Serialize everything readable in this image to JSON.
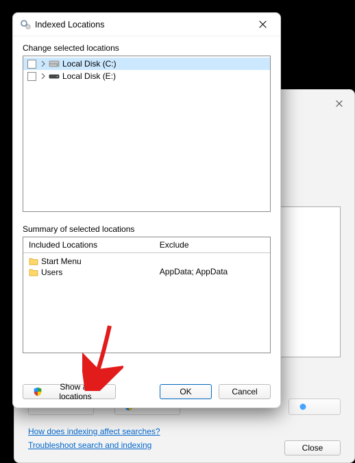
{
  "dialog": {
    "title": "Indexed Locations",
    "change_label": "Change selected locations",
    "summary_label": "Summary of selected locations",
    "headers": {
      "included": "Included Locations",
      "exclude": "Exclude"
    },
    "tree": [
      {
        "label": "Local Disk (C:)",
        "selected": true
      },
      {
        "label": "Local Disk (E:)",
        "selected": false
      }
    ],
    "included": [
      {
        "label": "Start Menu"
      },
      {
        "label": "Users"
      }
    ],
    "excluded_text": "AppData; AppData",
    "buttons": {
      "show_all": "Show all locations",
      "ok": "OK",
      "cancel": "Cancel"
    }
  },
  "parent": {
    "links": {
      "affect": "How does indexing affect searches?",
      "troubleshoot": "Troubleshoot search and indexing"
    },
    "close": "Close"
  }
}
